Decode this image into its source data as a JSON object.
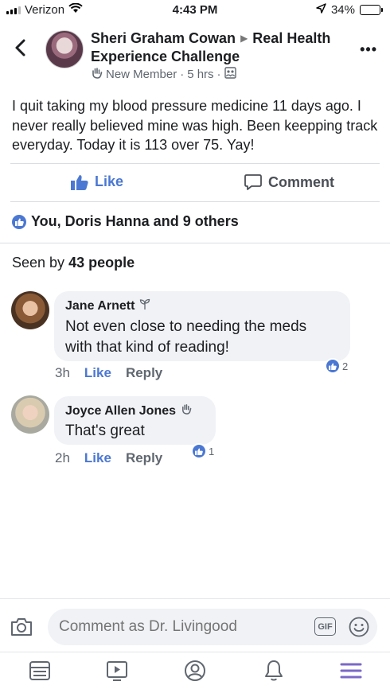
{
  "status_bar": {
    "carrier": "Verizon",
    "time": "4:43 PM",
    "battery": "34%",
    "battery_level": 0.34
  },
  "post": {
    "author": "Sheri Graham Cowan",
    "group_part1": "Real Health",
    "group_part2": "Experience Challenge",
    "badge": "New Member",
    "time": "5 hrs",
    "separator": "·",
    "body": "I quit taking my blood pressure medicine 11 days ago. I never really believed mine was high.  Been keepping track everyday.  Today it is 113 over 75. Yay!"
  },
  "actions": {
    "like_label": "Like",
    "comment_label": "Comment"
  },
  "reactions": {
    "summary": "You, Doris Hanna and 9 others"
  },
  "seen": {
    "prefix": "Seen by ",
    "count": "43 people"
  },
  "comments": [
    {
      "name": "Jane Arnett",
      "text_line1": "Not even close to needing the meds",
      "text_line2": "with that kind of reading!",
      "time": "3h",
      "like_label": "Like",
      "reply_label": "Reply",
      "reaction_count": "2"
    },
    {
      "name": "Joyce Allen Jones",
      "text_line1": "That's great",
      "time": "2h",
      "like_label": "Like",
      "reply_label": "Reply",
      "reaction_count": "1"
    }
  ],
  "composer": {
    "placeholder": "Comment as Dr. Livingood",
    "gif_label": "GIF"
  },
  "colors": {
    "accent": "#4b78d2",
    "bubble": "#f0f2f5",
    "muted": "#606770",
    "tab_active": "#7b68c8"
  }
}
